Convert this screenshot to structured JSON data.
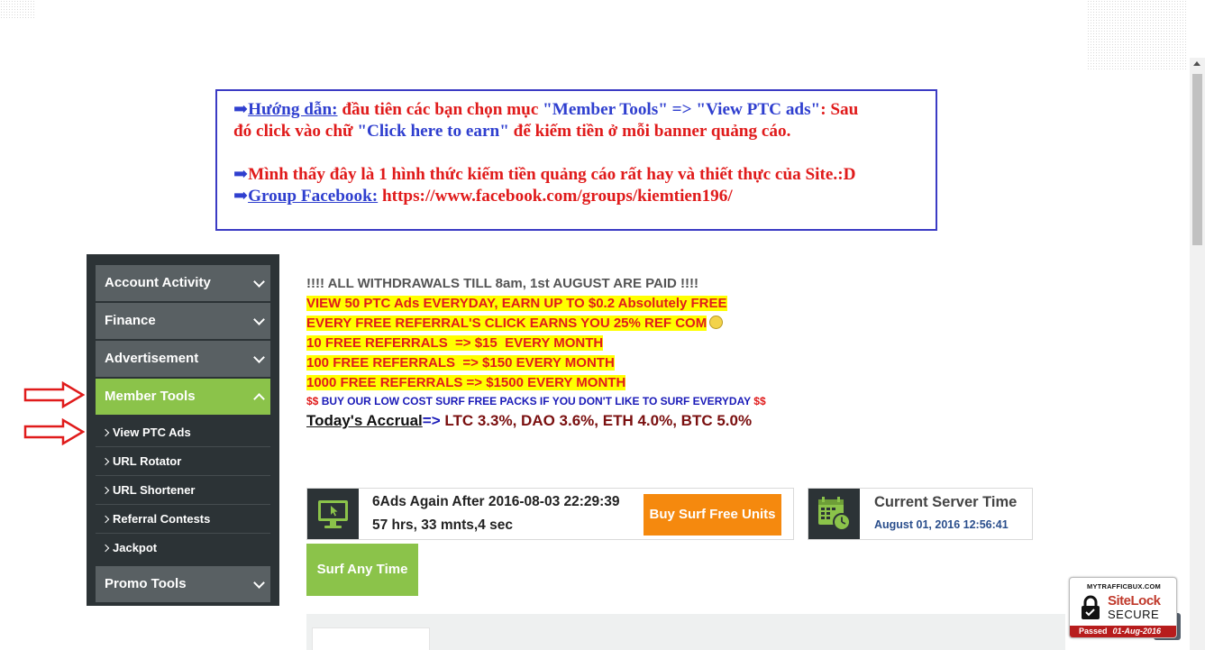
{
  "notice": {
    "line1_arrow": "➡",
    "line1_link": "Hướng dẫn:",
    "line1_text_a": " đầu tiên các bạn chọn mục ",
    "line1_quote_a": "\"Member Tools\" => \"View PTC ads\"",
    "line1_text_b": ": Sau",
    "line2_text_a": "đó click vào chữ ",
    "line2_quote": "\"Click here to earn\"",
    "line2_text_b": " để kiếm tiền ở mỗi banner quảng cáo.",
    "line3_arrow": "➡",
    "line3_text": "Mình thấy đây là 1 hình thức kiếm tiền quảng cáo rất hay và thiết thực của Site.:D",
    "line4_arrow": "➡",
    "line4_link": "Group Facebook:",
    "line4_url": " https://www.facebook.com/groups/kiemtien196/"
  },
  "sidebar": {
    "account_activity": "Account Activity",
    "finance": "Finance",
    "advertisement": "Advertisement",
    "member_tools": "Member Tools",
    "sub_items": [
      "View PTC Ads",
      "URL Rotator",
      "URL Shortener",
      "Referral Contests",
      "Jackpot"
    ],
    "promo_tools": "Promo Tools"
  },
  "announcements": {
    "withdrawals": "!!!! ALL WITHDRAWALS TILL 8am, 1st AUGUST ARE PAID !!!!",
    "view_ptc": "VIEW 50 PTC Ads EVERYDAY, EARN UP TO $0.2 Absolutely FREE",
    "ref_click": "EVERY FREE REFERRAL'S CLICK EARNS YOU 25% REF COM",
    "ref10": "10 FREE REFERRALS  => $15  EVERY MONTH",
    "ref100": "100 FREE REFERRALS  => $150 EVERY MONTH",
    "ref1000": "1000 FREE REFERRALS => $1500 EVERY MONTH",
    "packs_prefix": "$$",
    "packs_text": " BUY OUR LOW COST SURF FREE PACKS IF YOU DON'T LIKE TO SURF EVERYDAY ",
    "packs_suffix": "$$",
    "accrual_label": "Today's Accrual",
    "accrual_arrow": "=>",
    "accrual_values": " LTC 3.3%, DAO 3.6%, ETH 4.0%, BTC 5.0%"
  },
  "ads": {
    "again_line": "6Ads Again After 2016-08-03 22:29:39",
    "countdown": "57 hrs, 33 mnts,4 sec",
    "buy_button": "Buy Surf Free Units",
    "surf_button": "Surf Any Time"
  },
  "server_time": {
    "title": "Current Server Time",
    "value": "August 01, 2016 12:56:41"
  },
  "sitelock": {
    "domain": "MYTRAFFICBUX.COM",
    "brand": "SiteLock",
    "secure": "SECURE",
    "passed": "Passed",
    "date": "01-Aug-2016"
  },
  "colors": {
    "sidebar_bg": "#2c3336",
    "menu_item": "#596063",
    "active_green": "#8bc34a",
    "orange": "#f5890e",
    "notice_border": "#3b3bc4",
    "highlight": "#ffff00",
    "red_text": "#e01b1b"
  },
  "icons": [
    "monitor-cursor-icon",
    "calendar-clock-icon",
    "chevron-down-icon",
    "chevron-up-icon",
    "caret-right-icon",
    "smiley-icon",
    "padlock-icon",
    "red-arrow-icon"
  ]
}
